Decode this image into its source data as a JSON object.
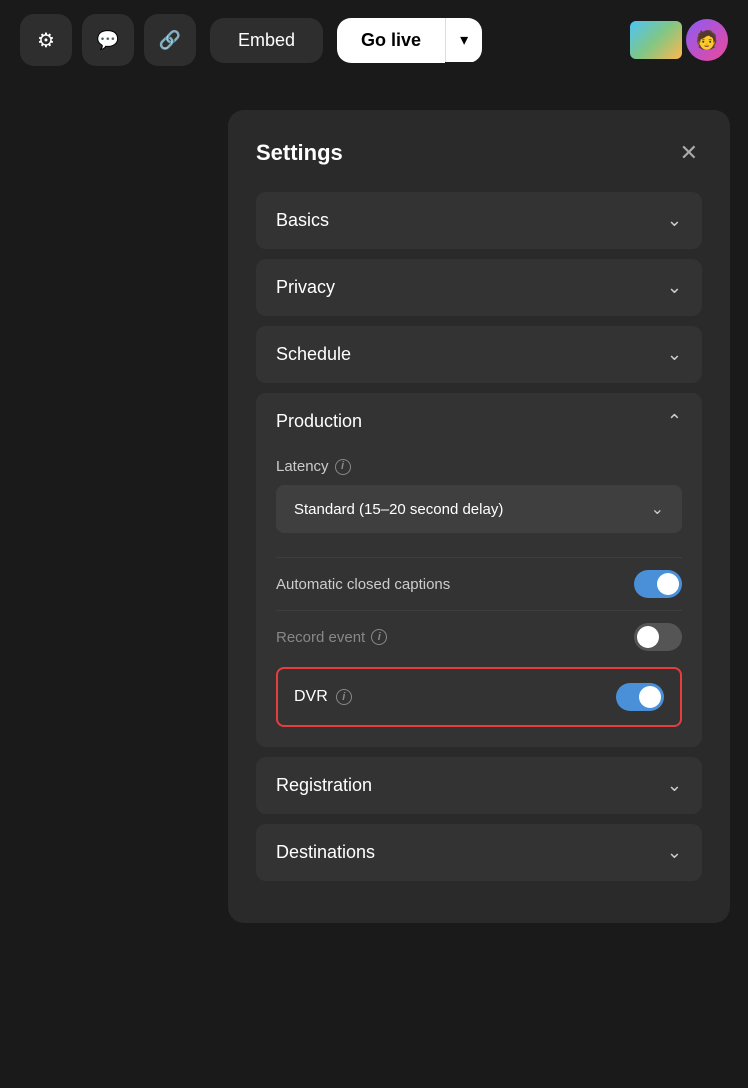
{
  "topbar": {
    "gear_icon": "⚙",
    "comment_icon": "💬",
    "link_icon": "🔗",
    "embed_label": "Embed",
    "go_live_label": "Go live",
    "dropdown_icon": "▾"
  },
  "settings": {
    "title": "Settings",
    "close_icon": "✕",
    "sections": [
      {
        "id": "basics",
        "label": "Basics",
        "expanded": false
      },
      {
        "id": "privacy",
        "label": "Privacy",
        "expanded": false
      },
      {
        "id": "schedule",
        "label": "Schedule",
        "expanded": false
      },
      {
        "id": "production",
        "label": "Production",
        "expanded": true
      },
      {
        "id": "registration",
        "label": "Registration",
        "expanded": false
      },
      {
        "id": "destinations",
        "label": "Destinations",
        "expanded": false
      }
    ],
    "production": {
      "latency_label": "Latency",
      "latency_value": "Standard (15–20 second delay)",
      "auto_captions_label": "Automatic closed captions",
      "auto_captions_on": true,
      "record_event_label": "Record event",
      "record_event_on": false,
      "dvr_label": "DVR",
      "dvr_on": true
    }
  }
}
